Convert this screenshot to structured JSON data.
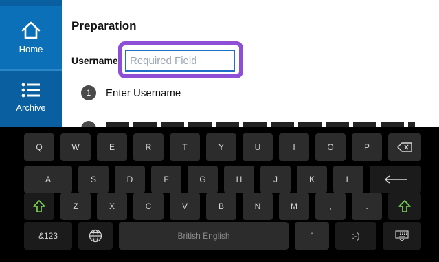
{
  "sidebar": {
    "items": [
      {
        "label": "Home",
        "icon": "home-icon"
      },
      {
        "label": "Archive",
        "icon": "list-icon"
      }
    ]
  },
  "main": {
    "title": "Preparation",
    "username_label": "Username",
    "username_input": {
      "value": "",
      "placeholder": "Required Field"
    },
    "steps": [
      {
        "number": "1",
        "text": "Enter Username"
      }
    ]
  },
  "keyboard": {
    "row1": [
      "Q",
      "W",
      "E",
      "R",
      "T",
      "Y",
      "U",
      "I",
      "O",
      "P"
    ],
    "row2": [
      "A",
      "S",
      "D",
      "F",
      "G",
      "H",
      "J",
      "K",
      "L"
    ],
    "row3": [
      "Z",
      "X",
      "C",
      "V",
      "B",
      "N",
      "M",
      ",",
      "."
    ],
    "symbols_key": "&123",
    "space_label": "British English",
    "apostrophe_key": "'",
    "emoticon_key": ":-)",
    "icons": {
      "backspace": "backspace-icon",
      "enter": "enter-icon",
      "shift": "shift-icon",
      "language": "globe-icon",
      "hide": "keyboard-icon"
    },
    "colors": {
      "shift_accent": "#7ed957"
    }
  },
  "colors": {
    "sidebar": "#0a5fa0",
    "focus_ring": "#8e4fd6",
    "input_border": "#1f6fc7"
  }
}
